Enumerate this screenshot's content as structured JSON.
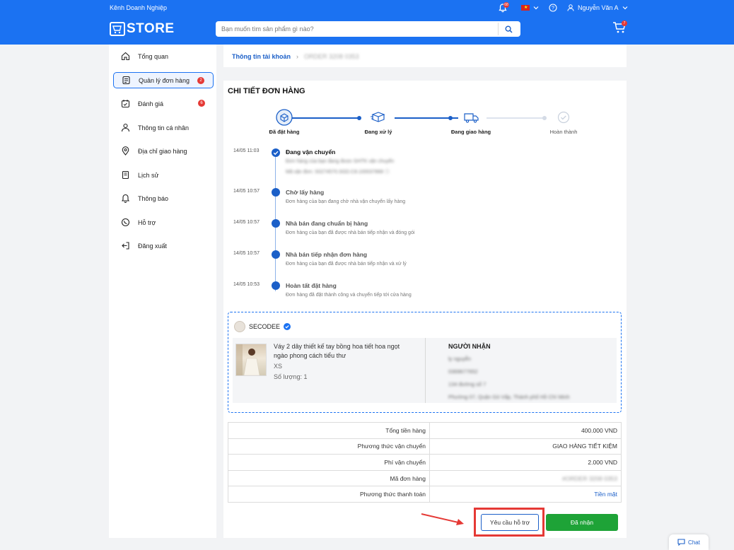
{
  "header": {
    "business_channel": "Kênh Doanh Nghiệp",
    "bell_badge": "68",
    "user_name": "Nguyễn Văn A",
    "logo_text": "STORE",
    "search_placeholder": "Bạn muốn tìm sản phẩm gì nào?",
    "cart_badge": "7"
  },
  "sidebar": {
    "items": [
      {
        "label": "Tổng quan",
        "icon": "home-icon"
      },
      {
        "label": "Quản lý đơn hàng",
        "icon": "order-list-icon",
        "badge": "2",
        "active": true
      },
      {
        "label": "Đánh giá",
        "icon": "review-icon",
        "badge": "6"
      },
      {
        "label": "Thông tin cá nhân",
        "icon": "person-icon"
      },
      {
        "label": "Địa chỉ giao hàng",
        "icon": "location-pin-icon"
      },
      {
        "label": "Lịch sử",
        "icon": "history-icon"
      },
      {
        "label": "Thông báo",
        "icon": "bell-icon"
      },
      {
        "label": "Hỗ trợ",
        "icon": "whatsapp-support-icon"
      },
      {
        "label": "Đăng xuất",
        "icon": "logout-icon"
      }
    ]
  },
  "breadcrumb": {
    "account": "Thông tin tài khoản",
    "current": "ORDER 3208 0353"
  },
  "order": {
    "title": "CHI TIẾT ĐƠN HÀNG",
    "steps": [
      {
        "label": "Đã đặt hàng",
        "done": true
      },
      {
        "label": "Đang xử lý",
        "done": true
      },
      {
        "label": "Đang giao hàng",
        "done": true
      },
      {
        "label": "Hoàn thành",
        "done": false
      }
    ],
    "timeline": [
      {
        "time": "14/05 11:03",
        "title": "Đang vận chuyển",
        "desc": "Đơn hàng của bạn đang được GHTK vận chuyển",
        "desc2": "Mã vận đơn: S0274570.SGD.C8.100037868 ⓘ"
      },
      {
        "time": "14/05 10:57",
        "title": "Chờ lấy hàng",
        "desc": "Đơn hàng của bạn đang chờ nhà vận chuyển lấy hàng"
      },
      {
        "time": "14/05 10:57",
        "title": "Nhà bán đang chuẩn bị hàng",
        "desc": "Đơn hàng của bạn đã được nhà bán tiếp nhận và đóng gói"
      },
      {
        "time": "14/05 10:57",
        "title": "Nhà bán tiếp nhận đơn hàng",
        "desc": "Đơn hàng của bạn đã được nhà bán tiếp nhận và xử lý"
      },
      {
        "time": "14/05 10:53",
        "title": "Hoàn tất đặt hàng",
        "desc": "Đơn hàng đã đặt thành công và chuyển tiếp tới cửa hàng"
      }
    ],
    "shop_name": "SECODEE",
    "product": {
      "name": "Váy 2 dây thiết kế tay bồng hoa tiết hoa ngọt ngào phong cách tiểu thư",
      "size": "XS",
      "quantity": "Số lượng: 1"
    },
    "recipient": {
      "title": "NGƯỜI NHẬN",
      "name": "ly nguyễn",
      "phone": "0369677652",
      "street": "134 đường số 7",
      "area": "Phường 07, Quận Gò Vấp, Thành phố Hồ Chí Minh"
    },
    "summary": [
      {
        "label": "Tổng tiền hàng",
        "value": "400.000 VND"
      },
      {
        "label": "Phương thức vận chuyển",
        "value": "GIAO HÀNG TIẾT KIỆM"
      },
      {
        "label": "Phí vận chuyển",
        "value": "2.000 VND"
      },
      {
        "label": "Mã đơn hàng",
        "value": "#ORDER 3208 0353",
        "blur": true
      },
      {
        "label": "Phương thức thanh toán",
        "value": "Tiền mặt",
        "link": true
      }
    ],
    "support_button": "Yêu cầu hỗ trợ",
    "received_button": "Đã nhận"
  },
  "chat_label": "Chat",
  "colors": {
    "brand_blue": "#1b72f2",
    "accent_blue": "#1b5fc8",
    "success_green": "#1ea337",
    "highlight_red": "#e53935"
  }
}
